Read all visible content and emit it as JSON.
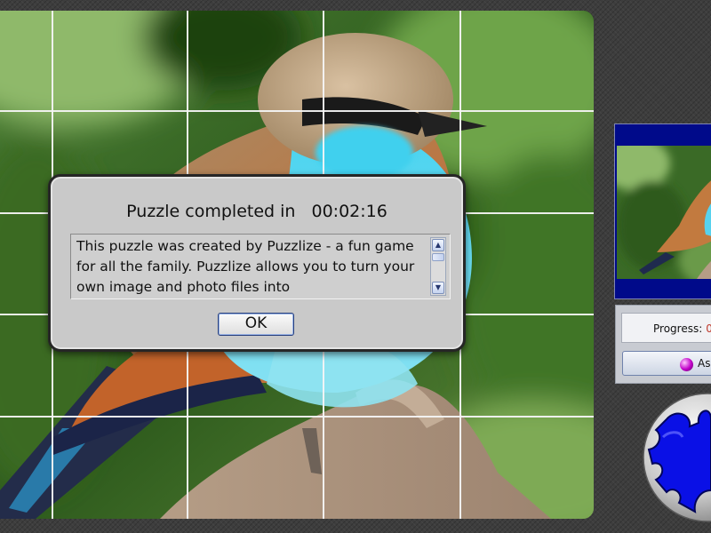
{
  "dialog": {
    "title": "Puzzle completed in",
    "time": "00:02:16",
    "message": "This puzzle was created by Puzzlize - a fun game for all the family. Puzzlize allows you to turn your own image and photo files into",
    "ok_label": "OK",
    "scroll_up_glyph": "▲",
    "scroll_down_glyph": "▼"
  },
  "sidebar": {
    "progress_label": "Progress:",
    "progress_value": "0",
    "assemble_label": "As"
  },
  "icons": {
    "dialog_scroll_up": "arrow-up-icon",
    "dialog_scroll_down": "arrow-down-icon",
    "assemble": "purple-ball-icon",
    "logo": "puzzle-piece-logo"
  },
  "colors": {
    "preview_frame": "#000a8a",
    "puzzle_logo_piece": "#0a10e6",
    "progress_value": "#c0392b",
    "ok_button_border": "#28407d"
  }
}
